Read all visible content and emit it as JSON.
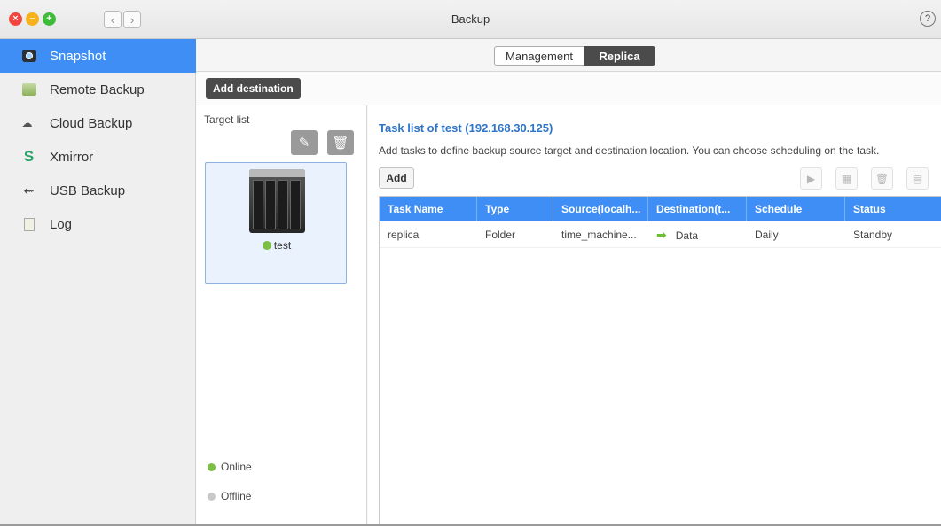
{
  "window": {
    "title": "Backup",
    "help_icon": "?"
  },
  "sidebar": {
    "items": [
      {
        "label": "Snapshot",
        "icon": "snapshot-icon",
        "active": true
      },
      {
        "label": "Remote Backup",
        "icon": "remote-backup-icon",
        "active": false
      },
      {
        "label": "Cloud Backup",
        "icon": "cloud-backup-icon",
        "active": false
      },
      {
        "label": "Xmirror",
        "icon": "xmirror-icon",
        "active": false
      },
      {
        "label": "USB Backup",
        "icon": "usb-icon",
        "active": false
      },
      {
        "label": "Log",
        "icon": "log-icon",
        "active": false
      }
    ]
  },
  "tabs": {
    "management": "Management",
    "replica": "Replica",
    "selected": "Replica"
  },
  "toolbar": {
    "add_destination": "Add destination"
  },
  "targets": {
    "label": "Target list",
    "items": [
      {
        "name": "test",
        "status": "online"
      }
    ],
    "legend_online": "Online",
    "legend_offline": "Offline"
  },
  "tasks": {
    "title": "Task list of test (192.168.30.125)",
    "description": "Add tasks to define backup source target and destination location. You can choose scheduling on the task.",
    "add_label": "Add",
    "columns": [
      "Task Name",
      "Type",
      "Source(localh...",
      "Destination(t...",
      "Schedule",
      "Status"
    ],
    "rows": [
      {
        "name": "replica",
        "type": "Folder",
        "source": "time_machine...",
        "destination": "Data",
        "schedule": "Daily",
        "status": "Standby"
      }
    ]
  },
  "colors": {
    "accent": "#3e8ef5",
    "dark_button": "#4b4b4b",
    "online": "#7bc043",
    "offline": "#c9c9c9",
    "title_link": "#2e74c8"
  }
}
